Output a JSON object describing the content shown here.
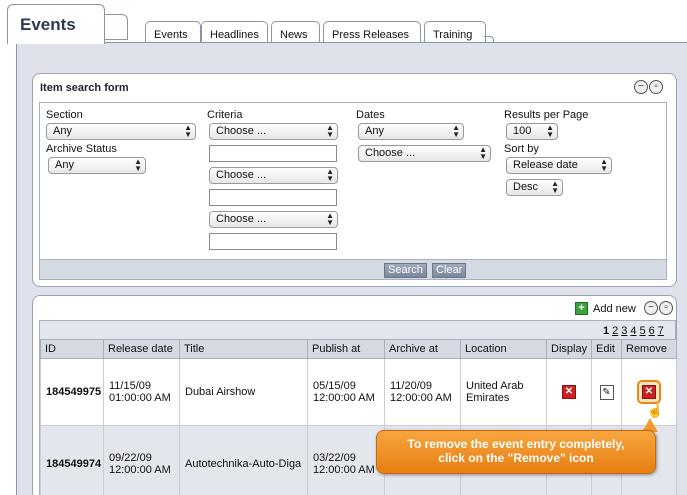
{
  "header": {
    "main_tab": "Events",
    "tabs": [
      "Events",
      "Headlines",
      "News",
      "Press Releases",
      "Training"
    ]
  },
  "search_form": {
    "title": "Item search form",
    "section_label": "Section",
    "section_value": "Any",
    "archive_label": "Archive Status",
    "archive_value": "Any",
    "criteria_label": "Criteria",
    "criteria_values": [
      "Choose ...",
      "Choose ...",
      "Choose ..."
    ],
    "dates_label": "Dates",
    "dates_value": "Any",
    "dates_choose": "Choose ...",
    "results_label": "Results per Page",
    "results_value": "100",
    "sort_label": "Sort by",
    "sort_value": "Release date",
    "order_value": "Desc",
    "search_button": "Search",
    "clear_button": "Clear"
  },
  "list": {
    "add_new": "Add new",
    "pages": [
      "1",
      "2",
      "3",
      "4",
      "5",
      "6",
      "7"
    ],
    "columns": [
      "ID",
      "Release date",
      "Title",
      "Publish at",
      "Archive at",
      "Location",
      "Display",
      "Edit",
      "Remove"
    ],
    "rows": [
      {
        "id": "184549975",
        "release_date": "11/15/09",
        "release_time": "01:00:00 AM",
        "title": "Dubai Airshow",
        "publish_date": "05/15/09",
        "publish_time": "12:00:00 AM",
        "archive_date": "11/20/09",
        "archive_time": "12:00:00 AM",
        "location_line1": "United Arab",
        "location_line2": "Emirates"
      },
      {
        "id": "184549974",
        "release_date": "09/22/09",
        "release_time": "12:00:00 AM",
        "title": "Autotechnika-Auto-Diga",
        "publish_date": "03/22/09",
        "publish_time": "12:00:00 AM",
        "archive_date": "",
        "archive_time": "",
        "location_line1": "",
        "location_line2": ""
      }
    ]
  },
  "callout": {
    "line1": "To remove the event entry completely,",
    "line2": "click on the \"Remove\" icon"
  },
  "colors": {
    "callout": "#e98a1c",
    "panel_gray": "#d5d9e2",
    "remove_red": "#cc2222"
  }
}
